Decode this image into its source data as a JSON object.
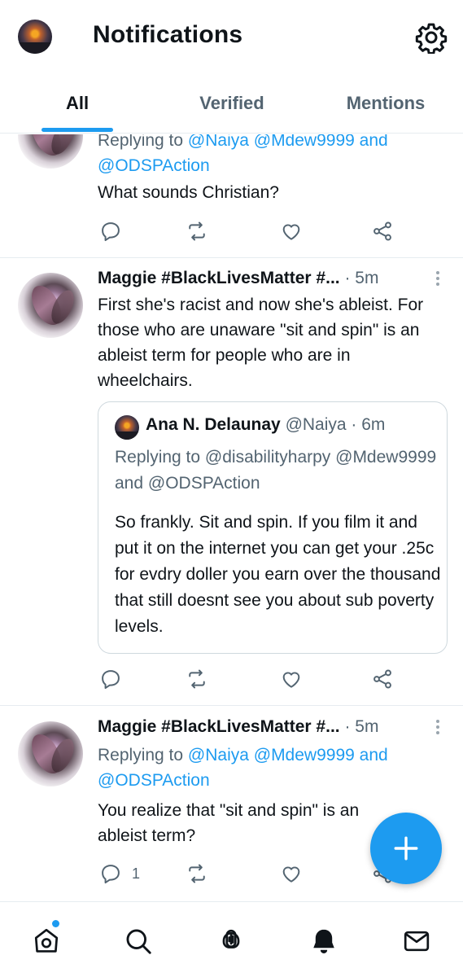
{
  "header": {
    "title": "Notifications",
    "avatar_icon": "user-avatar-sunset",
    "settings_icon": "gear-icon"
  },
  "tabs": [
    {
      "label": "All",
      "active": true
    },
    {
      "label": "Verified",
      "active": false
    },
    {
      "label": "Mentions",
      "active": false
    }
  ],
  "tweets": [
    {
      "reply_prefix": "Replying to",
      "reply_handles": "@Naiya @Mdew9999 and @ODSPAction",
      "text": "What sounds Christian?",
      "reply_count": ""
    },
    {
      "author": "Maggie #BlackLivesMatter #...",
      "time": "· 5m",
      "text": "First she's racist and now she's ableist. For those who are unaware \"sit and spin\" is an ableist term for people who are in wheelchairs.",
      "reply_count": "",
      "quote": {
        "author": "Ana N. Delaunay",
        "handle": "@Naiya · 6m",
        "reply_prefix": "Replying to",
        "reply_handles": "@disabilityharpy @Mdew9999 and @ODSPAction",
        "text": "So frankly. Sit and spin. If you film it and put it on the internet you can get your .25c for evdry doller you earn over the thousand that still doesnt see you about sub poverty levels."
      }
    },
    {
      "author": "Maggie #BlackLivesMatter #...",
      "time": "· 5m",
      "reply_prefix": "Replying to",
      "reply_handles": "@Naiya @Mdew9999 and @ODSPAction",
      "text": "You realize that \"sit and spin\" is an ableist term?",
      "reply_count": "1"
    }
  ],
  "fab": {
    "icon": "plus-icon"
  },
  "bottom_nav": [
    {
      "icon": "home-icon",
      "has_badge": true
    },
    {
      "icon": "search-icon"
    },
    {
      "icon": "spaces-icon"
    },
    {
      "icon": "bell-icon",
      "active": true
    },
    {
      "icon": "mail-icon"
    }
  ],
  "colors": {
    "accent": "#1d9bf0",
    "text_primary": "#0f1419",
    "text_secondary": "#536471",
    "divider": "#e6ecf0"
  }
}
